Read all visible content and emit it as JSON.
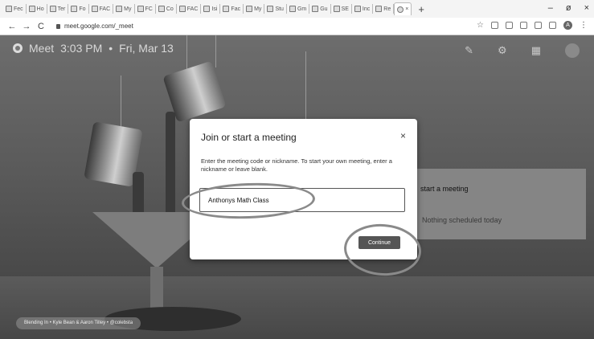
{
  "browser": {
    "tabs": [
      "Fec",
      "Ho",
      "Ter",
      "Fo",
      "FAC",
      "My",
      "FC",
      "Co",
      "FAC",
      "Isi",
      "Fac",
      "My",
      "Stu",
      "Gm",
      "Gu",
      "SE",
      "Inc",
      "Re"
    ],
    "active_tab_icon": "meet-icon",
    "close_tab": "×",
    "new_tab": "+",
    "window_controls": {
      "minimize": "–",
      "maximize": "ø",
      "close": "×"
    },
    "url": "meet.google.com/_meet",
    "nav": {
      "back": "←",
      "forward": "→",
      "reload": "C"
    },
    "profile_initial": "A"
  },
  "meet": {
    "app_name": "Meet",
    "time": "3:03 PM",
    "separator": "•",
    "date": "Fri, Mar 13",
    "side_card": {
      "title": "start a meeting",
      "subtitle": "Nothing scheduled today"
    },
    "credit": "Blending In • Kyle Bean & Aaron Tilley • @colebsta"
  },
  "dialog": {
    "title": "Join or start a meeting",
    "close": "×",
    "description": "Enter the meeting code or nickname. To start your own meeting, enter a nickname or leave blank.",
    "input_value": "Anthonys Math Class",
    "continue_label": "Continue"
  },
  "colors": {
    "dialog_bg": "#ffffff",
    "continue_bg": "#555555",
    "stage_bg": "#5a5a5a",
    "annotation": "#8a8a8a"
  }
}
